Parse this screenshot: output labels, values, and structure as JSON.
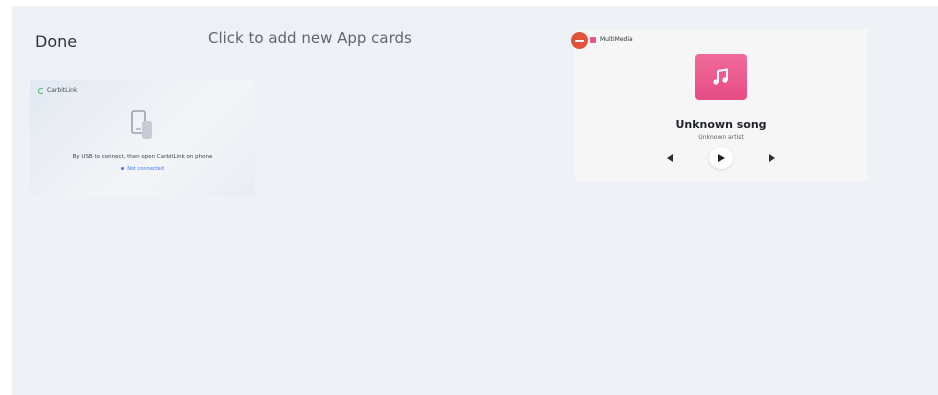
{
  "header": {
    "done_label": "Done",
    "add_cards_label": "Click to add new App cards"
  },
  "cards": {
    "carbitlink": {
      "title": "CarbitLink",
      "message": "By USB to connect, then open CarbitLink on phone",
      "status": "Not connected"
    },
    "multimedia": {
      "title": "MultiMedia",
      "song_title": "Unknown song",
      "artist": "Unknown artist",
      "icons": {
        "remove": "minus-circle-icon",
        "album": "music-note-icon",
        "prev": "previous-icon",
        "play": "play-icon",
        "next": "next-icon"
      }
    }
  },
  "colors": {
    "background": "#eef1f5",
    "remove_red": "#e2523b",
    "album_pink": "#e64c85",
    "carbit_green": "#3cbf6a",
    "link_blue": "#3b7cf3"
  }
}
